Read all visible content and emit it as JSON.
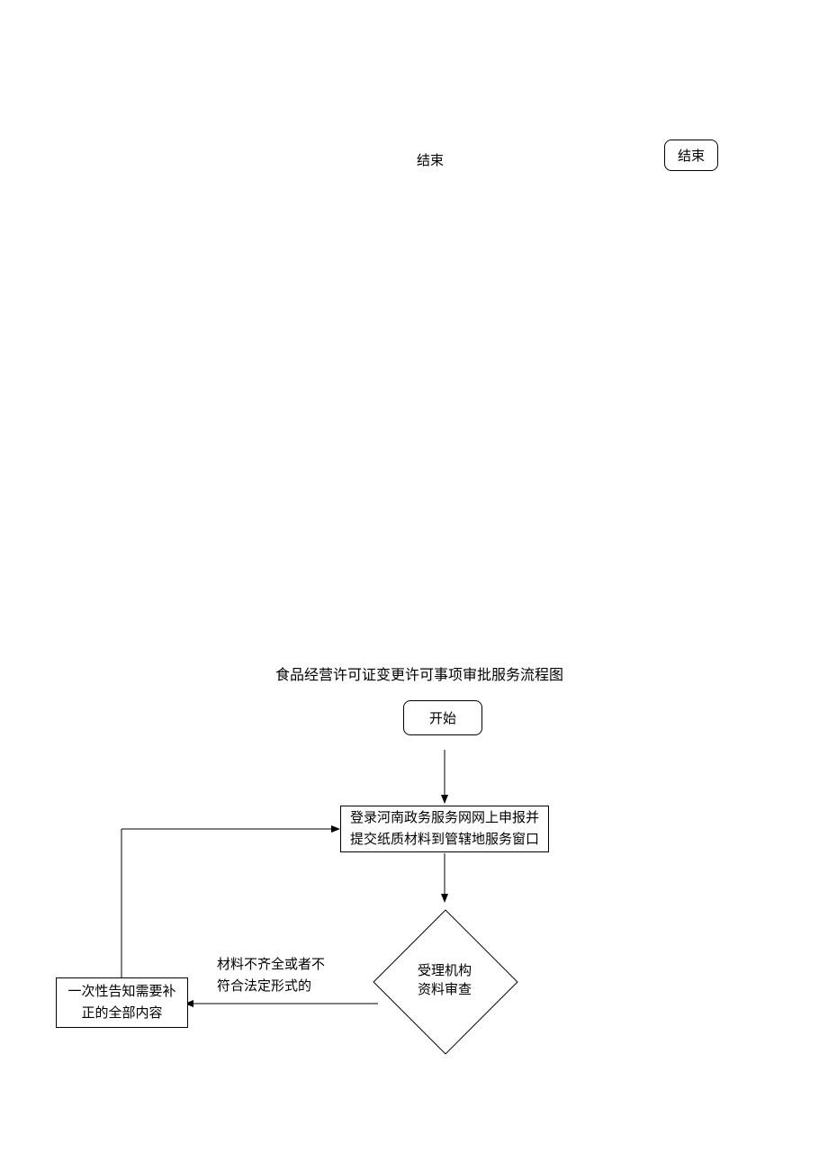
{
  "topEnds": {
    "left": "结束",
    "right": "结束"
  },
  "title": "食品经营许可证变更许可事项审批服务流程图",
  "nodes": {
    "start": "开始",
    "submit_line1": "登录河南政务服务网网上申报并",
    "submit_line2": "提交纸质材料到管辖地服务窗口",
    "decision_line1": "受理机构",
    "decision_line2": "资料审查",
    "inform_line1": "一次性告知需要补",
    "inform_line2": "正的全部内容"
  },
  "edgeLabels": {
    "incomplete_line1": "材料不齐全或者不",
    "incomplete_line2": "符合法定形式的"
  }
}
